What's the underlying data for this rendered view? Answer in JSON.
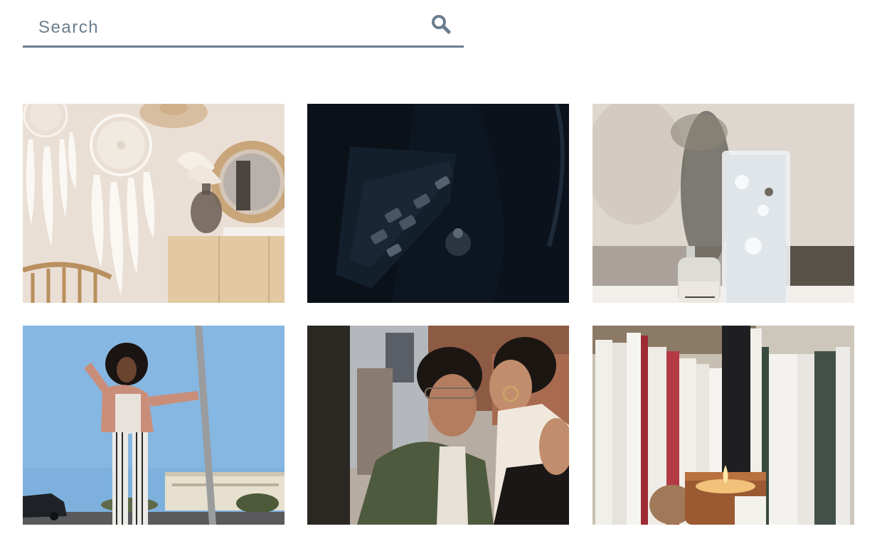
{
  "search": {
    "placeholder": "Search",
    "icon": "search-icon"
  },
  "gallery": {
    "photos": [
      {
        "subject": "dreamcatchers-wall"
      },
      {
        "subject": "car-door-controls"
      },
      {
        "subject": "glass-and-bottle"
      },
      {
        "subject": "woman-with-pole"
      },
      {
        "subject": "couple-kiss"
      },
      {
        "subject": "books-and-candle"
      }
    ]
  },
  "colors": {
    "accent": "#6b7d8f",
    "background": "#ffffff"
  }
}
